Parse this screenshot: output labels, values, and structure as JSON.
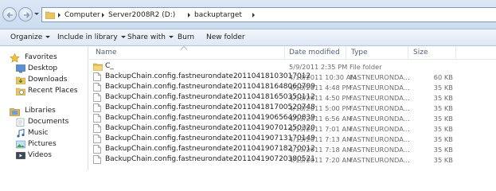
{
  "address": {
    "breadcrumbs": [
      "Computer",
      "Server2008R2 (D:)",
      "backuptarget"
    ]
  },
  "toolbar": {
    "organize": "Organize",
    "include_in_library": "Include in library",
    "share_with": "Share with",
    "burn": "Burn",
    "new_folder": "New folder"
  },
  "nav": {
    "favorites": "Favorites",
    "desktop": "Desktop",
    "downloads": "Downloads",
    "recent_places": "Recent Places",
    "libraries": "Libraries",
    "documents": "Documents",
    "music": "Music",
    "pictures": "Pictures",
    "videos": "Videos"
  },
  "columns": {
    "name": "Name",
    "date_modified": "Date modified",
    "type": "Type",
    "size": "Size"
  },
  "files": [
    {
      "name": "C_",
      "date": "5/9/2011 2:35 PM",
      "type": "File folder",
      "size": "",
      "is_folder": true
    },
    {
      "name": "BackupChain.config.fastneurondate20110418103017012",
      "date": "4/18/2011 10:30 AM",
      "type": "FASTNEURONDA...",
      "size": "60 KB",
      "is_folder": false
    },
    {
      "name": "BackupChain.config.fastneurondate20110418164806070​9",
      "date": "4/18/2011 4:48 PM",
      "type": "FASTNEURONDA...",
      "size": "35 KB",
      "is_folder": false
    },
    {
      "name": "BackupChain.config.fastneurondate20110418165035011​2",
      "date": "4/18/2011 4:50 PM",
      "type": "FASTNEURONDA...",
      "size": "35 KB",
      "is_folder": false
    },
    {
      "name": "BackupChain.config.fastneurondate20110418170052074​8",
      "date": "4/18/2011 5:00 PM",
      "type": "FASTNEURONDA...",
      "size": "35 KB",
      "is_folder": false
    },
    {
      "name": "BackupChain.config.fastneurondate20110419065649083​9",
      "date": "4/19/2011 6:56 AM",
      "type": "FASTNEURONDA...",
      "size": "35 KB",
      "is_folder": false
    },
    {
      "name": "BackupChain.config.fastneurondate20110419070125032​0",
      "date": "4/19/2011 7:01 AM",
      "type": "FASTNEURONDA...",
      "size": "35 KB",
      "is_folder": false
    },
    {
      "name": "BackupChain.config.fastneurondate20110419071317014​9",
      "date": "4/19/2011 7:13 AM",
      "type": "FASTNEURONDA...",
      "size": "35 KB",
      "is_folder": false
    },
    {
      "name": "BackupChain.config.fastneurondate20110419071827001​2",
      "date": "4/19/2011 7:18 AM",
      "type": "FASTNEURONDA...",
      "size": "35 KB",
      "is_folder": false
    },
    {
      "name": "BackupChain.config.fastneurondate20110419072038052​1",
      "date": "4/19/2011 7:20 AM",
      "type": "FASTNEURONDA...",
      "size": "35 KB",
      "is_folder": false
    }
  ]
}
